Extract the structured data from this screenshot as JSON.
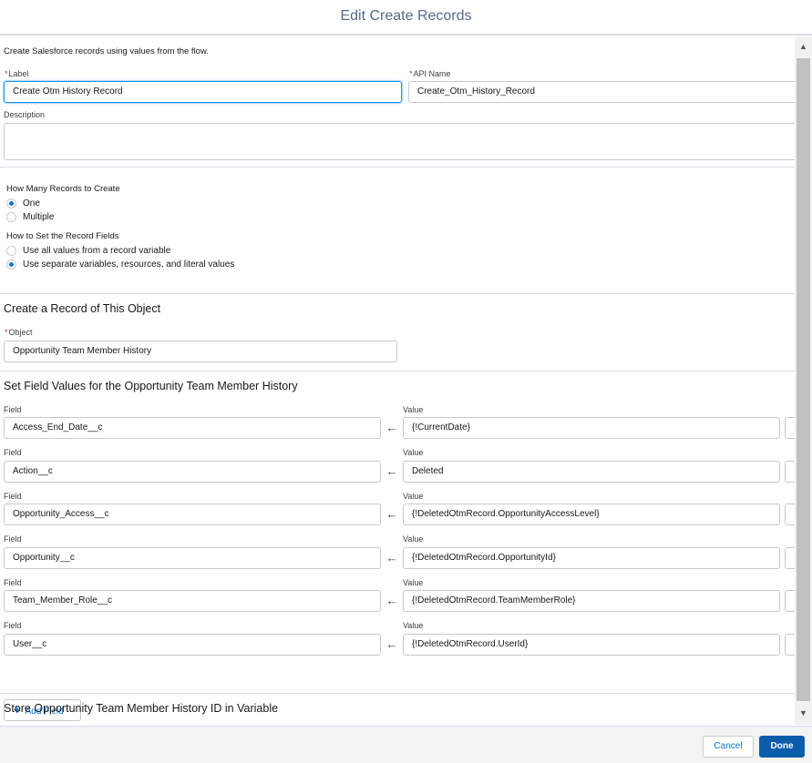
{
  "modal": {
    "title": "Edit Create Records"
  },
  "intro": "Create Salesforce records using values from the flow.",
  "label_field": {
    "required_mark": "*",
    "label": "Label",
    "value": "Create Otm History Record"
  },
  "api_name_field": {
    "required_mark": "*",
    "label": "API Name",
    "value": "Create_Otm_History_Record"
  },
  "description_field": {
    "label": "Description",
    "value": ""
  },
  "how_many": {
    "title": "How Many Records to Create",
    "options": [
      {
        "label": "One",
        "checked": true
      },
      {
        "label": "Multiple",
        "checked": false
      }
    ]
  },
  "how_to_set": {
    "title": "How to Set the Record Fields",
    "options": [
      {
        "label": "Use all values from a record variable",
        "checked": false
      },
      {
        "label": "Use separate variables, resources, and literal values",
        "checked": true
      }
    ]
  },
  "object_section": {
    "title": "Create a Record of This Object",
    "object_label": "Object",
    "required_mark": "*",
    "object_value": "Opportunity Team Member History"
  },
  "field_values": {
    "title": "Set Field Values for the Opportunity Team Member History",
    "field_label": "Field",
    "value_label": "Value",
    "arrow": "←",
    "rows": [
      {
        "field": "Access_End_Date__c",
        "value": "{!CurrentDate}"
      },
      {
        "field": "Action__c",
        "value": "Deleted"
      },
      {
        "field": "Opportunity_Access__c",
        "value": "{!DeletedOtmRecord.OpportunityAccessLevel}"
      },
      {
        "field": "Opportunity__c",
        "value": "{!DeletedOtmRecord.OpportunityId}"
      },
      {
        "field": "Team_Member_Role__c",
        "value": "{!DeletedOtmRecord.TeamMemberRole}"
      },
      {
        "field": "User__c",
        "value": "{!DeletedOtmRecord.UserId}"
      }
    ],
    "add_button": "Add Field"
  },
  "store_section": {
    "title": "Store Opportunity Team Member History ID in Variable"
  },
  "footer": {
    "cancel": "Cancel",
    "done": "Done"
  },
  "icons": {
    "add": "+",
    "scroll_up": "▲",
    "scroll_down": "▼"
  },
  "colors": {
    "brand": "#0b5cab",
    "link": "#0176d3",
    "focus": "#1b96ff",
    "required": "#c23934"
  }
}
